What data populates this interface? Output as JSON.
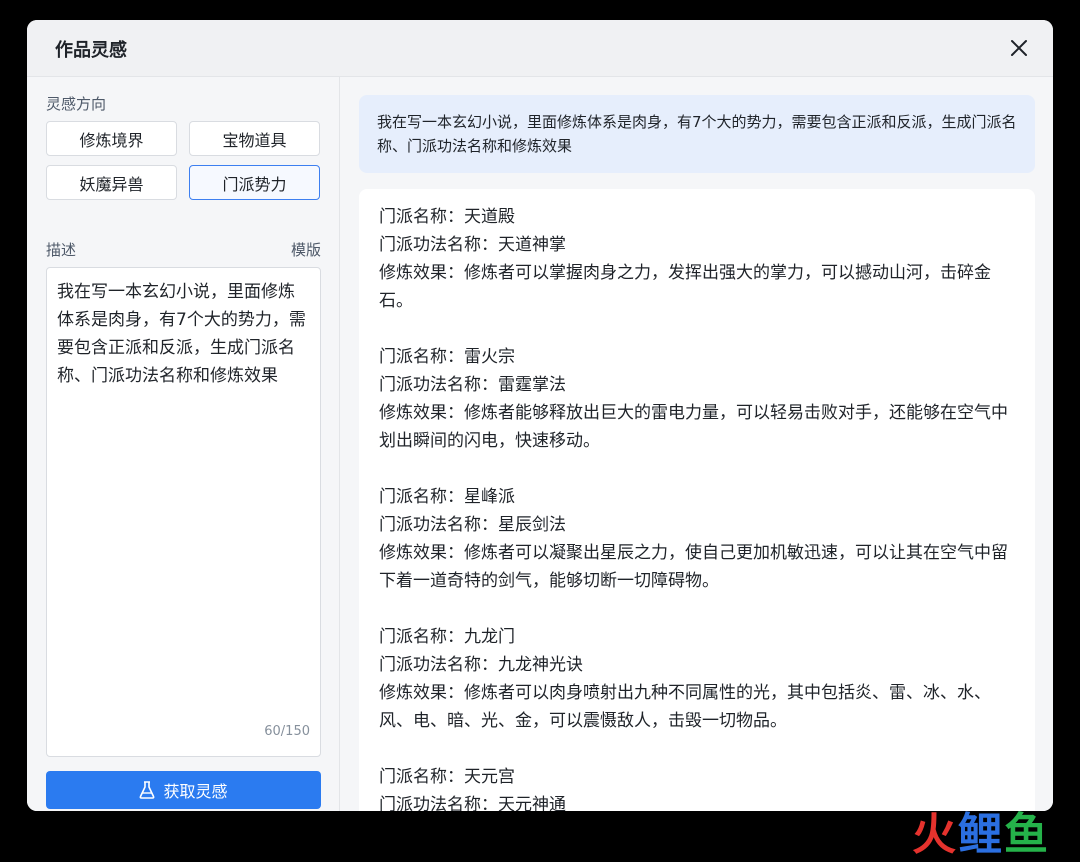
{
  "dialog": {
    "title": "作品灵感"
  },
  "left": {
    "direction_label": "灵感方向",
    "categories": [
      {
        "label": "修炼境界"
      },
      {
        "label": "宝物道具"
      },
      {
        "label": "妖魔异兽"
      },
      {
        "label": "门派势力"
      }
    ],
    "active_category": "门派势力",
    "description_label": "描述",
    "template_label": "模版",
    "description_value": "我在写一本玄幻小说，里面修炼体系是肉身，有7个大的势力，需要包含正派和反派，生成门派名称、门派功法名称和修炼效果",
    "char_count": "60/150",
    "submit_label": "获取灵感"
  },
  "right": {
    "prompt": "我在写一本玄幻小说，里面修炼体系是肉身，有7个大的势力，需要包含正派和反派，生成门派名称、门派功法名称和修炼效果",
    "results": [
      {
        "name": "门派名称：天道殿",
        "skill": "门派功法名称：天道神掌",
        "effect": "修炼效果：修炼者可以掌握肉身之力，发挥出强大的掌力，可以撼动山河，击碎金石。"
      },
      {
        "name": "门派名称：雷火宗",
        "skill": "门派功法名称：雷霆掌法",
        "effect": "修炼效果：修炼者能够释放出巨大的雷电力量，可以轻易击败对手，还能够在空气中划出瞬间的闪电，快速移动。"
      },
      {
        "name": "门派名称：星峰派",
        "skill": "门派功法名称：星辰剑法",
        "effect": "修炼效果：修炼者可以凝聚出星辰之力，使自己更加机敏迅速，可以让其在空气中留下着一道奇特的剑气，能够切断一切障碍物。"
      },
      {
        "name": "门派名称：九龙门",
        "skill": "门派功法名称：九龙神光诀",
        "effect": "修炼效果：修炼者可以肉身喷射出九种不同属性的光，其中包括炎、雷、冰、水、风、电、暗、光、金，可以震慑敌人，击毁一切物品。"
      },
      {
        "name": "门派名称：天元宫",
        "skill": "门派功法名称：天元神通",
        "effect": ""
      }
    ]
  },
  "watermark": {
    "c1": "火",
    "c2": "鲤",
    "c3": "鱼"
  }
}
